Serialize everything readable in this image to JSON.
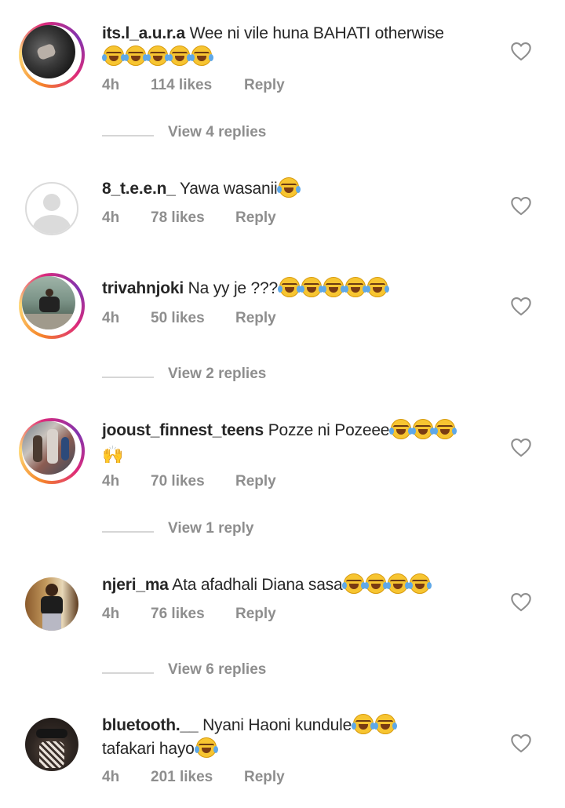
{
  "comments": [
    {
      "username": "its.l_a.u.r.a",
      "text": "Wee ni vile huna BAHATI otherwise",
      "emoji_line2": 5,
      "time": "4h",
      "likes": "114 likes",
      "reply": "Reply",
      "view_replies": "View 4 replies"
    },
    {
      "username": "8_t.e.e.n_",
      "text": "Yawa wasanii",
      "time": "4h",
      "likes": "78 likes",
      "reply": "Reply"
    },
    {
      "username": "trivahnjoki",
      "text": "Na yy je ???",
      "time": "4h",
      "likes": "50 likes",
      "reply": "Reply",
      "view_replies": "View 2 replies"
    },
    {
      "username": "jooust_finnest_teens",
      "text": "Pozze ni Pozeee",
      "time": "4h",
      "likes": "70 likes",
      "reply": "Reply",
      "view_replies": "View 1 reply"
    },
    {
      "username": "njeri_ma",
      "text": "Ata afadhali Diana sasa",
      "time": "4h",
      "likes": "76 likes",
      "reply": "Reply",
      "view_replies": "View 6 replies"
    },
    {
      "username": "bluetooth.__",
      "text": "Nyani Haoni kundule",
      "text_line2": "tafakari hayo",
      "time": "4h",
      "likes": "201 likes",
      "reply": "Reply"
    }
  ],
  "icons": {
    "like": "heart-outline-icon",
    "emoji": "face-with-tears-of-joy-icon",
    "hands": "raising-hands-icon"
  },
  "colors": {
    "secondary_text": "#8e8e8e",
    "primary_text": "#262626"
  }
}
